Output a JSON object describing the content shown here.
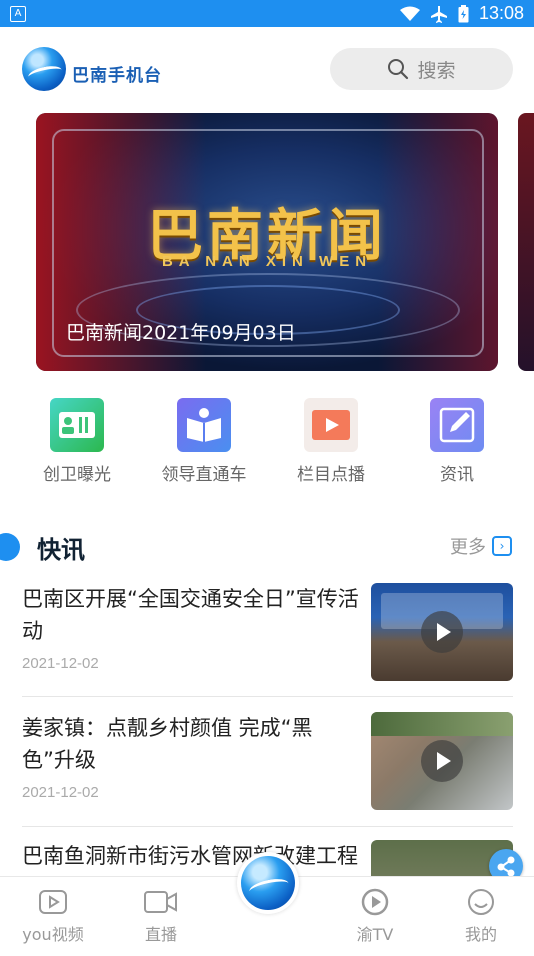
{
  "status_bar": {
    "time": "13:08",
    "left_icon_letter": "A"
  },
  "header": {
    "brand": "巴南手机台",
    "search_label": "搜索"
  },
  "banner": {
    "title": "巴南新闻",
    "subtitle": "BA NAN XIN WEN",
    "caption": "巴南新闻2021年09月03日"
  },
  "quick_links": [
    {
      "label": "创卫曝光",
      "icon": "id-card-icon"
    },
    {
      "label": "领导直通车",
      "icon": "book-user-icon"
    },
    {
      "label": "栏目点播",
      "icon": "play-icon"
    },
    {
      "label": "资讯",
      "icon": "edit-icon"
    }
  ],
  "section": {
    "title": "快讯",
    "more": "更多"
  },
  "news": [
    {
      "title": "巴南区开展“全国交通安全日”宣传活动",
      "date": "2021-12-02"
    },
    {
      "title": "姜家镇：点靓乡村颜值 完成“黑色”升级",
      "date": "2021-12-02"
    },
    {
      "title": "巴南鱼洞新市街污水管网新改建工程完工",
      "date": ""
    }
  ],
  "tabs": [
    {
      "label": "you视频"
    },
    {
      "label": "直播"
    },
    {
      "label": "渝TV"
    },
    {
      "label": "我的"
    }
  ]
}
